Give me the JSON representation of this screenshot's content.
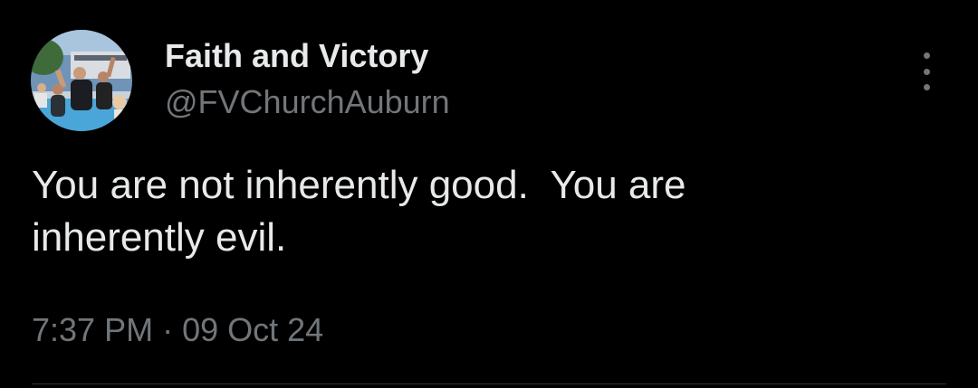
{
  "tweet": {
    "display_name": "Faith and Victory",
    "handle": "@FVChurchAuburn",
    "text": "You are not inherently good.  You are\ninherently evil.",
    "time": "7:37 PM",
    "separator": "·",
    "date": "09 Oct 24",
    "more_icon": "more-vertical-icon"
  },
  "colors": {
    "background": "#000000",
    "primary_text": "#e7e9ea",
    "secondary_text": "#71767b",
    "divider": "#2f3336"
  }
}
